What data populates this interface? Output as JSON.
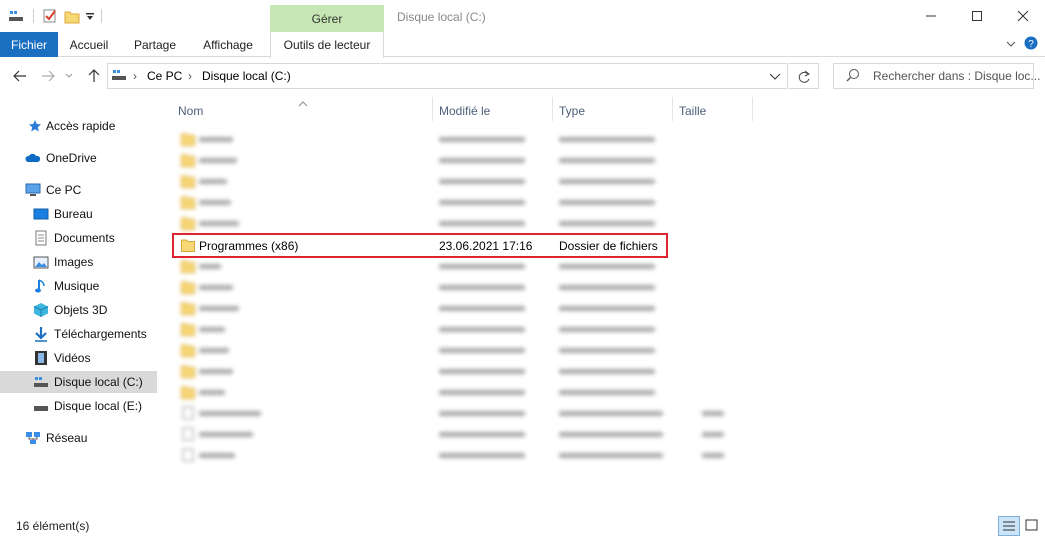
{
  "window": {
    "title": "Disque local (C:)",
    "context_group": "Gérer"
  },
  "ribbon": {
    "tabs": [
      "Fichier",
      "Accueil",
      "Partage",
      "Affichage",
      "Outils de lecteur"
    ]
  },
  "address": {
    "breadcrumb": [
      "Ce PC",
      "Disque local (C:)"
    ],
    "search_placeholder": "Rechercher dans : Disque loc..."
  },
  "nav_pane": {
    "items": [
      {
        "label": "Accès rapide",
        "icon": "star-icon"
      },
      {
        "label": "OneDrive",
        "icon": "cloud-icon"
      },
      {
        "label": "Ce PC",
        "icon": "computer-icon"
      },
      {
        "label": "Bureau",
        "icon": "desktop-icon"
      },
      {
        "label": "Documents",
        "icon": "documents-icon"
      },
      {
        "label": "Images",
        "icon": "images-icon"
      },
      {
        "label": "Musique",
        "icon": "music-icon"
      },
      {
        "label": "Objets 3D",
        "icon": "3d-objects-icon"
      },
      {
        "label": "Téléchargements",
        "icon": "download-icon"
      },
      {
        "label": "Vidéos",
        "icon": "video-icon"
      },
      {
        "label": "Disque local (C:)",
        "icon": "drive-icon"
      },
      {
        "label": "Disque local (E:)",
        "icon": "drive-icon"
      },
      {
        "label": "Réseau",
        "icon": "network-icon"
      }
    ]
  },
  "file_list": {
    "columns": [
      "Nom",
      "Modifié le",
      "Type",
      "Taille"
    ],
    "highlighted_row": {
      "name": "Programmes (x86)",
      "modified": "23.06.2021 17:16",
      "type": "Dossier de fichiers",
      "size": ""
    }
  },
  "status": {
    "item_count": "16 élément(s)"
  },
  "colors": {
    "accent": "#1a6fc1",
    "manage_tab": "#c6e6b3",
    "highlight_border": "#e0242f",
    "folder": "#f8d775"
  }
}
